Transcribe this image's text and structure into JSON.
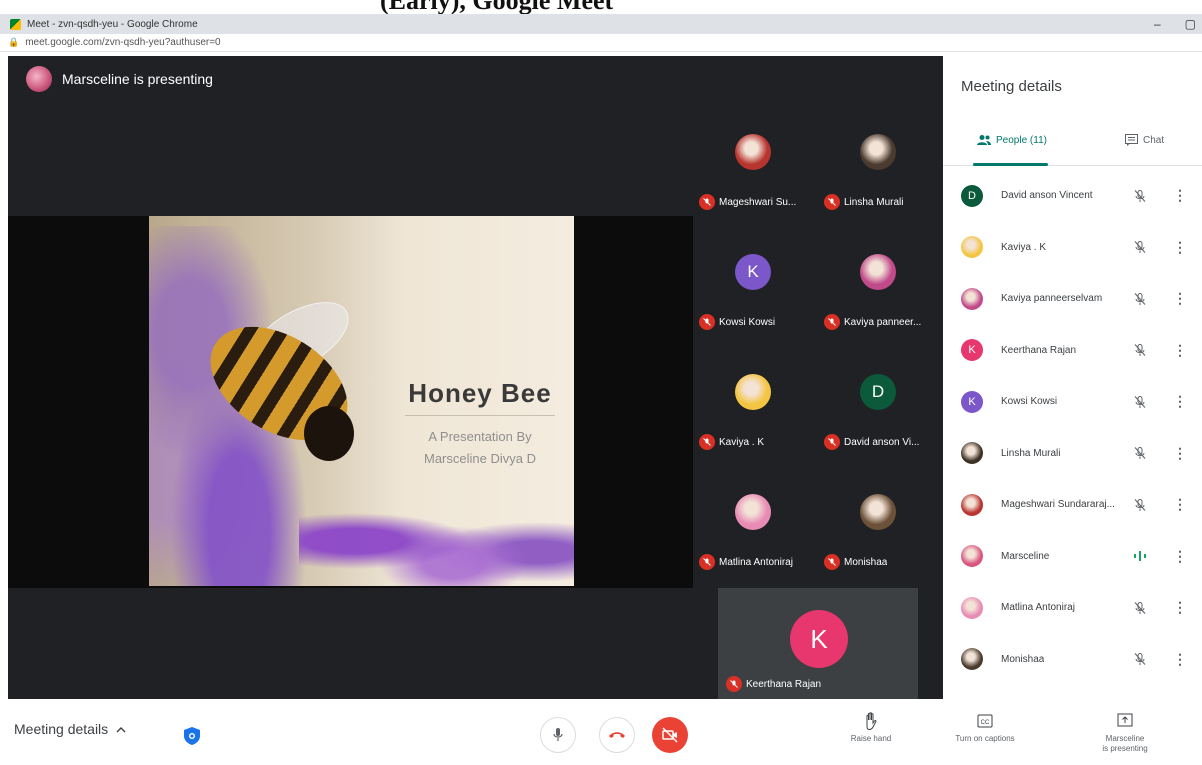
{
  "browser": {
    "window_title": "Meet - zvn-qsdh-yeu - Google Chrome",
    "url": "meet.google.com/zvn-qsdh-yeu?authuser=0",
    "controls": [
      "–",
      "▢"
    ]
  },
  "heading_fragment": "(Early), Google Meet",
  "stage": {
    "presenter_text": "Marsceline is presenting",
    "slide": {
      "title": "Honey Bee",
      "subtitle_line1": "A Presentation By",
      "subtitle_line2": "Marsceline Divya D"
    }
  },
  "tiles": [
    {
      "name": "Mageshwari Su...",
      "initial": "",
      "color": "#b7342f",
      "kind": "photo"
    },
    {
      "name": "Linsha Murali",
      "initial": "",
      "color": "#4a3b2e",
      "kind": "photo"
    },
    {
      "name": "Kowsi Kowsi",
      "initial": "K",
      "color": "#7b57c9",
      "kind": "letter"
    },
    {
      "name": "Kaviya panneer...",
      "initial": "",
      "color": "#c04a8a",
      "kind": "photo"
    },
    {
      "name": "Kaviya . K",
      "initial": "",
      "color": "#f4c542",
      "kind": "photo"
    },
    {
      "name": "David anson Vi...",
      "initial": "D",
      "color": "#0b5a3c",
      "kind": "letter"
    },
    {
      "name": "Matlina Antoniraj",
      "initial": "",
      "color": "#e88bb5",
      "kind": "photo"
    },
    {
      "name": "Monishaa",
      "initial": "",
      "color": "#6b5138",
      "kind": "photo"
    }
  ],
  "self_tile": {
    "name": "Keerthana Rajan",
    "initial": "K"
  },
  "panel": {
    "title": "Meeting details",
    "tab_people": "People (11)",
    "tab_chat": "Chat",
    "people": [
      {
        "name": "David anson Vincent",
        "initial": "D",
        "color": "#0b5a3c",
        "status": "muted"
      },
      {
        "name": "Kaviya . K",
        "initial": "",
        "color": "#f4c542",
        "status": "muted"
      },
      {
        "name": "Kaviya panneerselvam",
        "initial": "",
        "color": "#c04a8a",
        "status": "muted"
      },
      {
        "name": "Keerthana Rajan",
        "initial": "K",
        "color": "#e8366e",
        "status": "muted"
      },
      {
        "name": "Kowsi Kowsi",
        "initial": "K",
        "color": "#7b57c9",
        "status": "muted"
      },
      {
        "name": "Linsha Murali",
        "initial": "",
        "color": "#3d3126",
        "status": "muted"
      },
      {
        "name": "Mageshwari Sundararaj...",
        "initial": "",
        "color": "#b7342f",
        "status": "muted"
      },
      {
        "name": "Marsceline",
        "initial": "",
        "color": "#d9557f",
        "status": "speaking"
      },
      {
        "name": "Matlina Antoniraj",
        "initial": "",
        "color": "#e88bb5",
        "status": "muted"
      },
      {
        "name": "Monishaa",
        "initial": "",
        "color": "#4a3b2e",
        "status": "muted"
      }
    ]
  },
  "bottom": {
    "meeting_details": "Meeting details",
    "raise_hand": "Raise hand",
    "captions": "Turn on captions",
    "present_line1": "Marsceline",
    "present_line2": "is presenting"
  },
  "colors": {
    "accent": "#00796b",
    "end_call": "#ea4335",
    "mute_badge": "#d93025"
  },
  "icons": [
    "shield-icon",
    "mic-icon",
    "end-call-icon",
    "camera-off-icon",
    "raise-hand-icon",
    "captions-icon",
    "present-icon",
    "people-icon",
    "chat-icon",
    "mic-off-icon",
    "more-icon"
  ]
}
